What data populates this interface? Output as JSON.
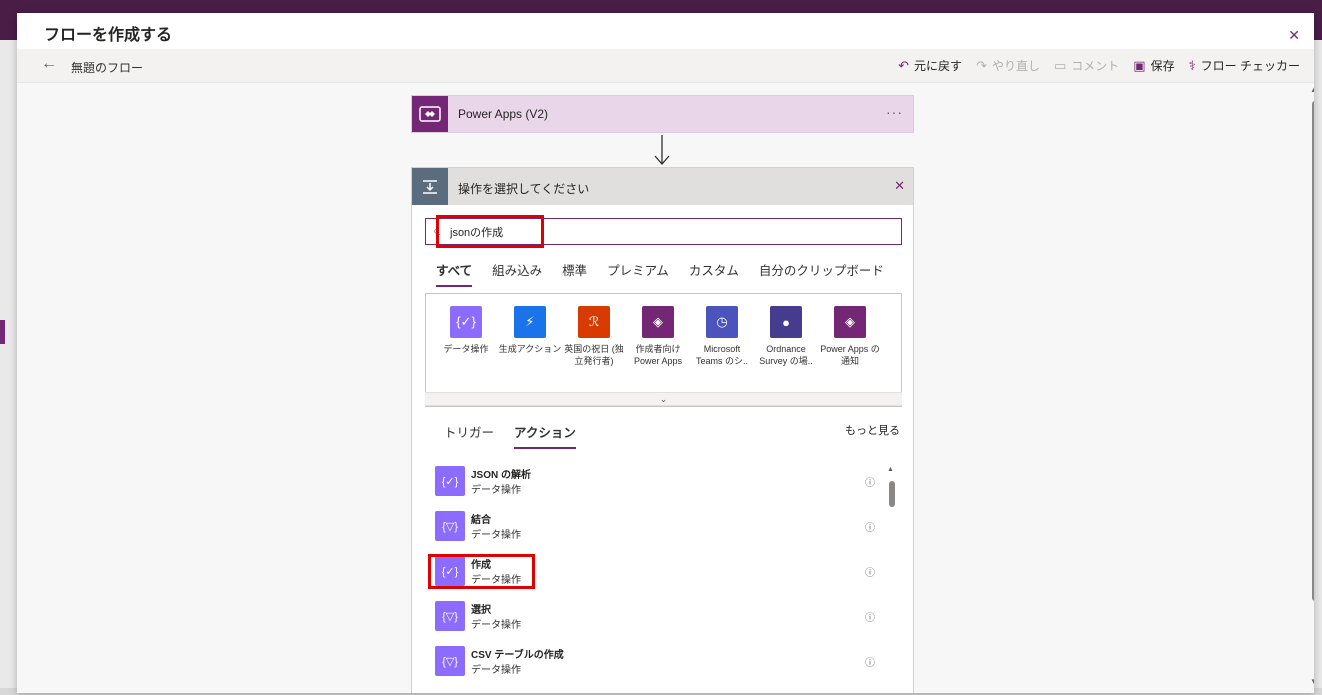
{
  "window": {
    "title": "フローを作成する"
  },
  "toolbar": {
    "flow_name": "無題のフロー",
    "undo": "元に戻す",
    "redo": "やり直し",
    "comment": "コメント",
    "save": "保存",
    "checker": "フロー チェッカー"
  },
  "trigger": {
    "label": "Power Apps (V2)",
    "more": "···"
  },
  "operation": {
    "title": "操作を選択してください",
    "search_value": "jsonの作成",
    "tabs": [
      "すべて",
      "組み込み",
      "標準",
      "プレミアム",
      "カスタム",
      "自分のクリップボード"
    ],
    "connectors": [
      {
        "label": "データ操作",
        "color": "#8c6cff",
        "icon": "{✓}"
      },
      {
        "label": "生成アクション",
        "color": "#1a73e8",
        "icon": "⚡"
      },
      {
        "label": "英国の祝日 (独立発行者)",
        "color": "#d83b01",
        "icon": "ℛ"
      },
      {
        "label": "作成者向け Power Apps",
        "color": "#742774",
        "icon": "◈"
      },
      {
        "label": "Microsoft Teams のシ..",
        "color": "#4b53bc",
        "icon": "◷"
      },
      {
        "label": "Ordnance Survey の場..",
        "color": "#453c90",
        "icon": "●"
      },
      {
        "label": "Power Apps の通知",
        "color": "#742774",
        "icon": "◈"
      }
    ],
    "sub_tabs": [
      "トリガー",
      "アクション"
    ],
    "see_more": "もっと見る",
    "actions": [
      {
        "name": "JSON の解析",
        "sub": "データ操作",
        "icon": "{✓}"
      },
      {
        "name": "結合",
        "sub": "データ操作",
        "icon": "{▽}"
      },
      {
        "name": "作成",
        "sub": "データ操作",
        "icon": "{✓}"
      },
      {
        "name": "選択",
        "sub": "データ操作",
        "icon": "{▽}"
      },
      {
        "name": "CSV テーブルの作成",
        "sub": "データ操作",
        "icon": "{▽}"
      }
    ]
  },
  "colors": {
    "accent": "#742774",
    "highlight": "#e00000",
    "data_ops": "#8c6cff"
  }
}
